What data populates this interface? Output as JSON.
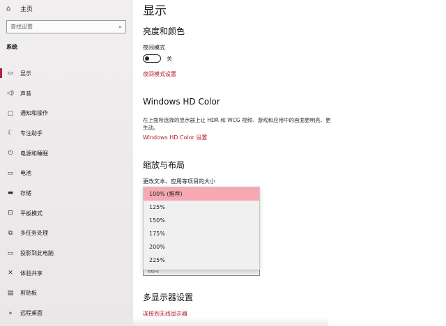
{
  "sidebar": {
    "home_label": "主页",
    "search_placeholder": "查找设置",
    "section_heading": "系统",
    "items": [
      {
        "label": "显示",
        "icon": "monitor-icon",
        "glyph": "▭"
      },
      {
        "label": "声音",
        "icon": "speaker-icon",
        "glyph": "◁)"
      },
      {
        "label": "通知和操作",
        "icon": "notification-icon",
        "glyph": "▢"
      },
      {
        "label": "专注助手",
        "icon": "moon-icon",
        "glyph": "☾"
      },
      {
        "label": "电源和睡眠",
        "icon": "power-icon",
        "glyph": "⏻"
      },
      {
        "label": "电池",
        "icon": "battery-icon",
        "glyph": "▭"
      },
      {
        "label": "存储",
        "icon": "storage-icon",
        "glyph": "▬"
      },
      {
        "label": "平板模式",
        "icon": "tablet-icon",
        "glyph": "⊡"
      },
      {
        "label": "多任务处理",
        "icon": "multitasking-icon",
        "glyph": "⧉"
      },
      {
        "label": "投影到此电脑",
        "icon": "projection-icon",
        "glyph": "▭"
      },
      {
        "label": "体验共享",
        "icon": "share-icon",
        "glyph": "✕"
      },
      {
        "label": "剪贴板",
        "icon": "clipboard-icon",
        "glyph": "▤"
      },
      {
        "label": "远程桌面",
        "icon": "remote-desktop-icon",
        "glyph": "»"
      }
    ]
  },
  "main": {
    "title": "显示",
    "brightness_heading": "亮度和颜色",
    "night_light_label": "夜间模式",
    "night_light_state": "关",
    "night_light_link": "夜间模式设置",
    "hd_color_heading": "Windows HD Color",
    "hd_color_desc": "在上面所选择的显示器上让 HDR 和 WCG 视频、游戏和应用中的画面更明亮、更生动。",
    "hd_color_link": "Windows HD Color 设置",
    "scale_heading": "缩放与布局",
    "scale_label": "更改文本、应用等项目的大小",
    "scale_options": [
      "100% (推荐)",
      "125%",
      "150%",
      "175%",
      "200%",
      "225%"
    ],
    "selected_option_index": 0,
    "orientation_partial": "横向",
    "multi_display_heading": "多显示器设置",
    "wireless_link": "连接到无线显示器"
  },
  "colors": {
    "accent": "#b51f3b",
    "link": "#b3192f",
    "selected_option": "#f7a9b3"
  }
}
